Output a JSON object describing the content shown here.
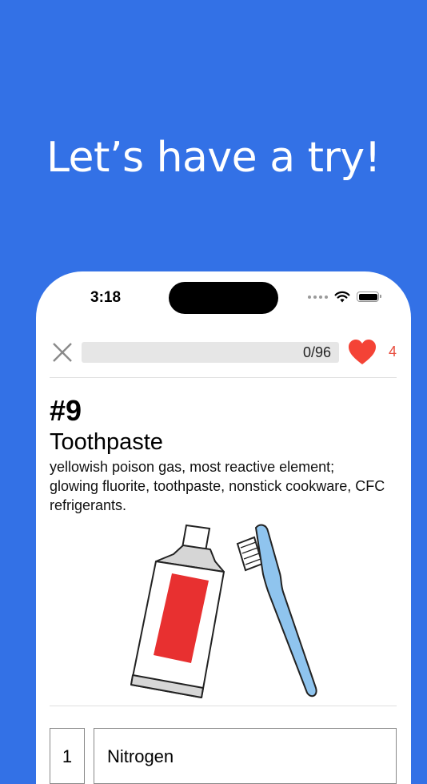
{
  "headline": "Let’s have a try!",
  "status_bar": {
    "time": "3:18"
  },
  "quiz": {
    "progress_text": "0/96",
    "progress_value": 0,
    "lives": "4",
    "heart_color": "#f44336"
  },
  "card": {
    "number": "#9",
    "title": "Toothpaste",
    "description": "yellowish poison gas, most reactive element; glowing fluorite, toothpaste, nonstick cookware, CFC refrigerants.",
    "illustration": [
      "toothpaste-tube",
      "toothbrush"
    ]
  },
  "answers": [
    {
      "index": "1",
      "label": "Nitrogen"
    }
  ],
  "colors": {
    "background": "#3371e6",
    "tube_label": "#e83030",
    "toothbrush": "#8fc4ee"
  }
}
